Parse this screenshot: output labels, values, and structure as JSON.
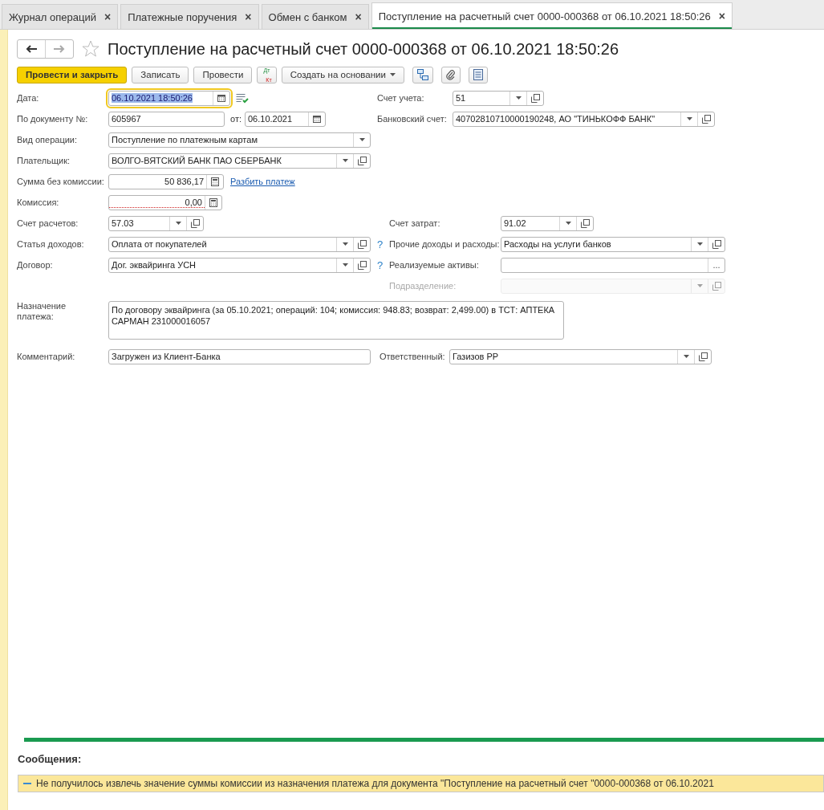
{
  "tabs": [
    {
      "label": "Журнал операций",
      "close": "×",
      "selected": false
    },
    {
      "label": "Платежные поручения",
      "close": "×",
      "selected": false
    },
    {
      "label": "Обмен с банком",
      "close": "×",
      "selected": false
    },
    {
      "label": "Поступление на расчетный счет 0000-000368 от 06.10.2021 18:50:26",
      "close": "×",
      "selected": true
    }
  ],
  "document": {
    "title": "Поступление на расчетный счет 0000-000368 от 06.10.2021 18:50:26",
    "favorite": false
  },
  "toolbar": {
    "post_and_close": "Провести и закрыть",
    "save": "Записать",
    "post": "Провести",
    "dt": "Дт",
    "kt": "Кт",
    "create_based_on": "Создать на основании"
  },
  "form": {
    "date": {
      "label": "Дата:",
      "value": "06.10.2021 18:50:26",
      "focused": true
    },
    "account": {
      "label": "Счет учета:",
      "value": "51"
    },
    "doc_number": {
      "label": "По документу №:",
      "value": "605967"
    },
    "doc_date": {
      "label": "от:",
      "value": "06.10.2021"
    },
    "bank_account": {
      "label": "Банковский счет:",
      "value": "40702810710000190248, АО \"ТИНЬКОФФ БАНК\""
    },
    "operation": {
      "label": "Вид операции:",
      "value": "Поступление по платежным картам"
    },
    "payer": {
      "label": "Плательщик:",
      "value": "ВОЛГО-ВЯТСКИЙ БАНК ПАО СБЕРБАНК"
    },
    "amount": {
      "label": "Сумма без комиссии:",
      "value": "50 836,17"
    },
    "split_link": "Разбить платеж",
    "commission": {
      "label": "Комиссия:",
      "value": "0,00",
      "invalid": true
    },
    "settlement_account": {
      "label": "Счет расчетов:",
      "value": "57.03"
    },
    "cost_account": {
      "label": "Счет затрат:",
      "value": "91.02"
    },
    "income_item": {
      "label": "Статья доходов:",
      "value": "Оплата от покупателей",
      "help": "?"
    },
    "other_income": {
      "label": "Прочие доходы и расходы:",
      "value": "Расходы на услуги банков"
    },
    "contract": {
      "label": "Договор:",
      "value": "Дог. эквайринга УСН",
      "help": "?"
    },
    "assets": {
      "label": "Реализуемые активы:",
      "choose": "..."
    },
    "department": {
      "label": "Подразделение:",
      "disabled": true
    },
    "purpose": {
      "label": "Назначение платежа:",
      "value": "По договору эквайринга (за 05.10.2021; операций: 104; комиссия: 948.83;  возврат: 2,499.00) в ТСТ: АПТЕКА САРМАН 231000016057"
    },
    "comment": {
      "label": "Комментарий:",
      "value": "Загружен из Клиент-Банка"
    },
    "responsible": {
      "label": "Ответственный:",
      "value": "Газизов РР"
    }
  },
  "messages": {
    "title": "Сообщения:",
    "items": [
      "Не получилось извлечь значение суммы комиссии из назначения платежа для документа \"Поступление на расчетный счет \"0000-000368 от 06.10.2021"
    ]
  }
}
